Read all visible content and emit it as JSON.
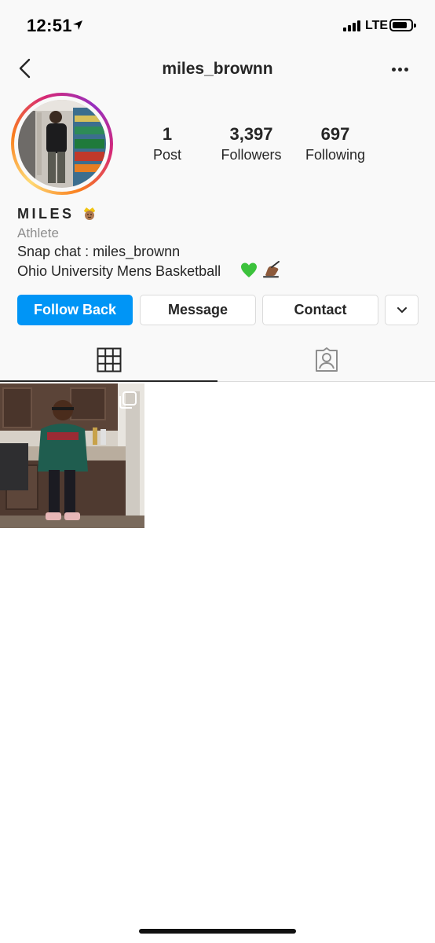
{
  "status_bar": {
    "time": "12:51",
    "network": "LTE"
  },
  "header": {
    "username": "miles_brownn"
  },
  "stats": [
    {
      "value": "1",
      "label": "Post"
    },
    {
      "value": "3,397",
      "label": "Followers"
    },
    {
      "value": "697",
      "label": "Following"
    }
  ],
  "profile": {
    "display_name": "MILES",
    "category": "Athlete",
    "bio_lines": [
      "Snap chat : miles_brownn",
      "Ohio University Mens Basketball"
    ]
  },
  "buttons": {
    "follow_back": "Follow Back",
    "message": "Message",
    "contact": "Contact"
  },
  "tabs": [
    {
      "icon": "grid-icon",
      "active": true
    },
    {
      "icon": "tagged-person-icon",
      "active": false
    }
  ],
  "posts": [
    {
      "type": "carousel",
      "icon": "multiple-posts-icon"
    }
  ],
  "colors": {
    "primary_button": "#0095f6",
    "story_ring": [
      "#feda75",
      "#fa7e1e",
      "#d62976",
      "#962fbf"
    ]
  }
}
